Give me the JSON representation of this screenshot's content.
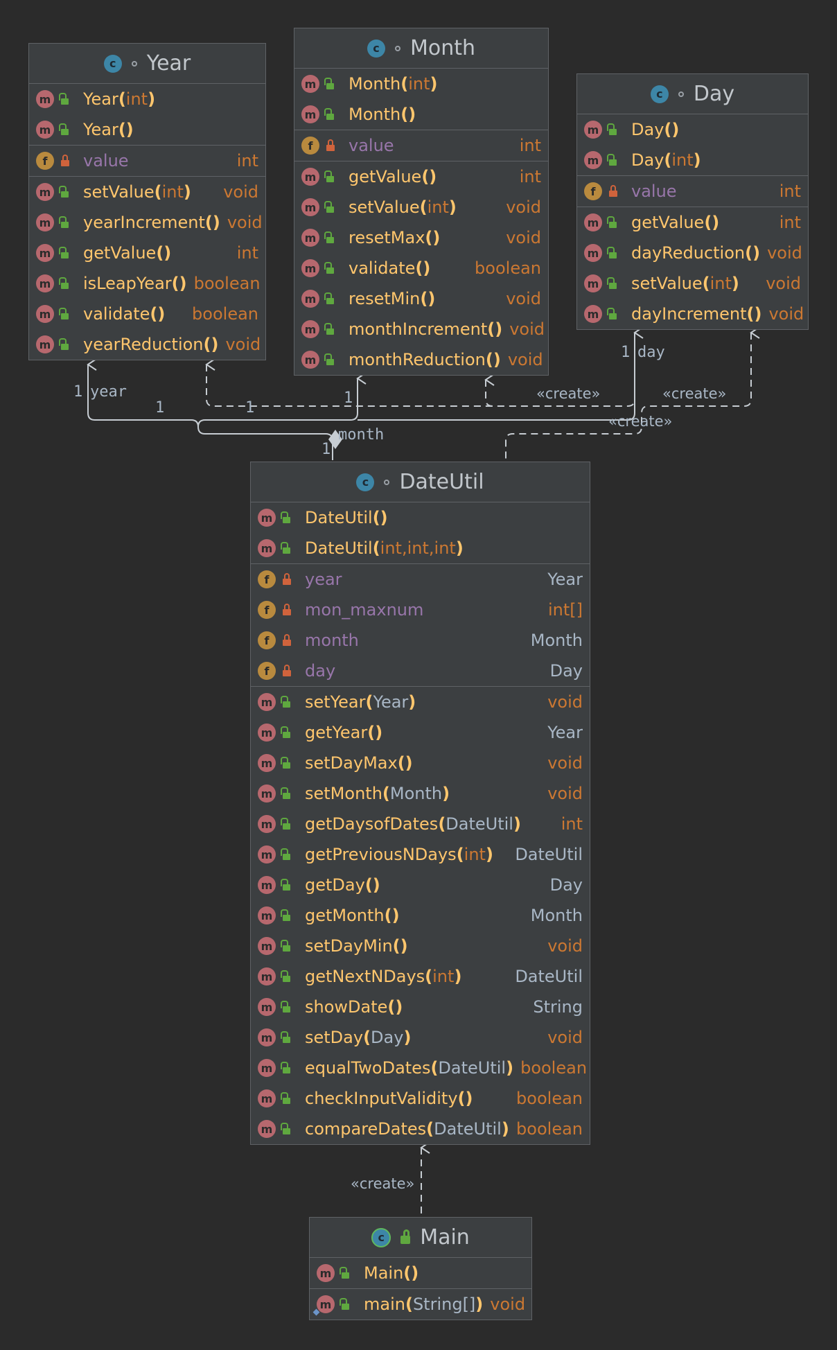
{
  "classes": {
    "year": {
      "name": "Year",
      "sections": [
        [
          {
            "kind": "m",
            "access": "pub",
            "name": "Year",
            "params": [
              {
                "t": "int",
                "p": true
              }
            ],
            "ret": ""
          },
          {
            "kind": "m",
            "access": "pub",
            "name": "Year",
            "params": [],
            "ret": ""
          }
        ],
        [
          {
            "kind": "f",
            "access": "priv",
            "name": "value",
            "ret": "int",
            "retPrim": true
          }
        ],
        [
          {
            "kind": "m",
            "access": "pub",
            "name": "setValue",
            "params": [
              {
                "t": "int",
                "p": true
              }
            ],
            "ret": "void",
            "retPrim": true
          },
          {
            "kind": "m",
            "access": "pub",
            "name": "yearIncrement",
            "params": [],
            "ret": "void",
            "retPrim": true
          },
          {
            "kind": "m",
            "access": "pub",
            "name": "getValue",
            "params": [],
            "ret": "int",
            "retPrim": true
          },
          {
            "kind": "m",
            "access": "pub",
            "name": "isLeapYear",
            "params": [],
            "ret": "boolean",
            "retPrim": true
          },
          {
            "kind": "m",
            "access": "pub",
            "name": "validate",
            "params": [],
            "ret": "boolean",
            "retPrim": true
          },
          {
            "kind": "m",
            "access": "pub",
            "name": "yearReduction",
            "params": [],
            "ret": "void",
            "retPrim": true
          }
        ]
      ]
    },
    "month": {
      "name": "Month",
      "sections": [
        [
          {
            "kind": "m",
            "access": "pub",
            "name": "Month",
            "params": [
              {
                "t": "int",
                "p": true
              }
            ],
            "ret": ""
          },
          {
            "kind": "m",
            "access": "pub",
            "name": "Month",
            "params": [],
            "ret": ""
          }
        ],
        [
          {
            "kind": "f",
            "access": "priv",
            "name": "value",
            "ret": "int",
            "retPrim": true
          }
        ],
        [
          {
            "kind": "m",
            "access": "pub",
            "name": "getValue",
            "params": [],
            "ret": "int",
            "retPrim": true
          },
          {
            "kind": "m",
            "access": "pub",
            "name": "setValue",
            "params": [
              {
                "t": "int",
                "p": true
              }
            ],
            "ret": "void",
            "retPrim": true
          },
          {
            "kind": "m",
            "access": "pub",
            "name": "resetMax",
            "params": [],
            "ret": "void",
            "retPrim": true
          },
          {
            "kind": "m",
            "access": "pub",
            "name": "validate",
            "params": [],
            "ret": "boolean",
            "retPrim": true
          },
          {
            "kind": "m",
            "access": "pub",
            "name": "resetMin",
            "params": [],
            "ret": "void",
            "retPrim": true
          },
          {
            "kind": "m",
            "access": "pub",
            "name": "monthIncrement",
            "params": [],
            "ret": "void",
            "retPrim": true
          },
          {
            "kind": "m",
            "access": "pub",
            "name": "monthReduction",
            "params": [],
            "ret": "void",
            "retPrim": true
          }
        ]
      ]
    },
    "day": {
      "name": "Day",
      "sections": [
        [
          {
            "kind": "m",
            "access": "pub",
            "name": "Day",
            "params": [],
            "ret": ""
          },
          {
            "kind": "m",
            "access": "pub",
            "name": "Day",
            "params": [
              {
                "t": "int",
                "p": true
              }
            ],
            "ret": ""
          }
        ],
        [
          {
            "kind": "f",
            "access": "priv",
            "name": "value",
            "ret": "int",
            "retPrim": true
          }
        ],
        [
          {
            "kind": "m",
            "access": "pub",
            "name": "getValue",
            "params": [],
            "ret": "int",
            "retPrim": true
          },
          {
            "kind": "m",
            "access": "pub",
            "name": "dayReduction",
            "params": [],
            "ret": "void",
            "retPrim": true
          },
          {
            "kind": "m",
            "access": "pub",
            "name": "setValue",
            "params": [
              {
                "t": "int",
                "p": true
              }
            ],
            "ret": "void",
            "retPrim": true
          },
          {
            "kind": "m",
            "access": "pub",
            "name": "dayIncrement",
            "params": [],
            "ret": "void",
            "retPrim": true
          }
        ]
      ]
    },
    "dateutil": {
      "name": "DateUtil",
      "sections": [
        [
          {
            "kind": "m",
            "access": "pub",
            "name": "DateUtil",
            "params": [],
            "ret": ""
          },
          {
            "kind": "m",
            "access": "pub",
            "name": "DateUtil",
            "params": [
              {
                "t": "int",
                "p": true
              },
              {
                "t": "int",
                "p": true
              },
              {
                "t": "int",
                "p": true
              }
            ],
            "ret": ""
          }
        ],
        [
          {
            "kind": "f",
            "access": "priv",
            "name": "year",
            "ret": "Year",
            "retPrim": false
          },
          {
            "kind": "f",
            "access": "priv",
            "name": "mon_maxnum",
            "ret": "int[]",
            "retPrim": true
          },
          {
            "kind": "f",
            "access": "priv",
            "name": "month",
            "ret": "Month",
            "retPrim": false
          },
          {
            "kind": "f",
            "access": "priv",
            "name": "day",
            "ret": "Day",
            "retPrim": false
          }
        ],
        [
          {
            "kind": "m",
            "access": "pub",
            "name": "setYear",
            "params": [
              {
                "t": "Year",
                "p": false
              }
            ],
            "ret": "void",
            "retPrim": true
          },
          {
            "kind": "m",
            "access": "pub",
            "name": "getYear",
            "params": [],
            "ret": "Year",
            "retPrim": false
          },
          {
            "kind": "m",
            "access": "pub",
            "name": "setDayMax",
            "params": [],
            "ret": "void",
            "retPrim": true
          },
          {
            "kind": "m",
            "access": "pub",
            "name": "setMonth",
            "params": [
              {
                "t": "Month",
                "p": false
              }
            ],
            "ret": "void",
            "retPrim": true
          },
          {
            "kind": "m",
            "access": "pub",
            "name": "getDaysofDates",
            "params": [
              {
                "t": "DateUtil",
                "p": false
              }
            ],
            "ret": "int",
            "retPrim": true
          },
          {
            "kind": "m",
            "access": "pub",
            "name": "getPreviousNDays",
            "params": [
              {
                "t": "int",
                "p": true
              }
            ],
            "ret": "DateUtil",
            "retPrim": false
          },
          {
            "kind": "m",
            "access": "pub",
            "name": "getDay",
            "params": [],
            "ret": "Day",
            "retPrim": false
          },
          {
            "kind": "m",
            "access": "pub",
            "name": "getMonth",
            "params": [],
            "ret": "Month",
            "retPrim": false
          },
          {
            "kind": "m",
            "access": "pub",
            "name": "setDayMin",
            "params": [],
            "ret": "void",
            "retPrim": true
          },
          {
            "kind": "m",
            "access": "pub",
            "name": "getNextNDays",
            "params": [
              {
                "t": "int",
                "p": true
              }
            ],
            "ret": "DateUtil",
            "retPrim": false
          },
          {
            "kind": "m",
            "access": "pub",
            "name": "showDate",
            "params": [],
            "ret": "String",
            "retPrim": false
          },
          {
            "kind": "m",
            "access": "pub",
            "name": "setDay",
            "params": [
              {
                "t": "Day",
                "p": false
              }
            ],
            "ret": "void",
            "retPrim": true
          },
          {
            "kind": "m",
            "access": "pub",
            "name": "equalTwoDates",
            "params": [
              {
                "t": "DateUtil",
                "p": false
              }
            ],
            "ret": "boolean",
            "retPrim": true
          },
          {
            "kind": "m",
            "access": "pub",
            "name": "checkInputValidity",
            "params": [],
            "ret": "boolean",
            "retPrim": true
          },
          {
            "kind": "m",
            "access": "pub",
            "name": "compareDates",
            "params": [
              {
                "t": "DateUtil",
                "p": false
              }
            ],
            "ret": "boolean",
            "retPrim": true
          }
        ]
      ]
    },
    "main": {
      "name": "Main",
      "sections": [
        [
          {
            "kind": "m",
            "access": "pub",
            "name": "Main",
            "params": [],
            "ret": ""
          }
        ],
        [
          {
            "kind": "m",
            "access": "pub",
            "name": "main",
            "params": [
              {
                "t": "String[]",
                "p": false
              }
            ],
            "ret": "void",
            "retPrim": true,
            "static": true
          }
        ]
      ]
    }
  },
  "edge_labels": {
    "year_role": "year",
    "year_mult": "1",
    "year_mult2": "1",
    "month_role": "month",
    "month_mult": "1",
    "month_mult_top": "1",
    "year_mult3": "1",
    "day_role": "day",
    "day_mult": "1",
    "create_month": "«create»",
    "create_day": "«create»",
    "create_year": "«create»",
    "create_dateutil": "«create»"
  },
  "colors": {
    "background": "#2b2b2b",
    "box": "#3c3f41",
    "method_name": "#ffc66d",
    "field_name": "#9876aa",
    "keyword": "#cc7832",
    "type": "#a9b7c6",
    "edge": "#c7cdd3"
  }
}
